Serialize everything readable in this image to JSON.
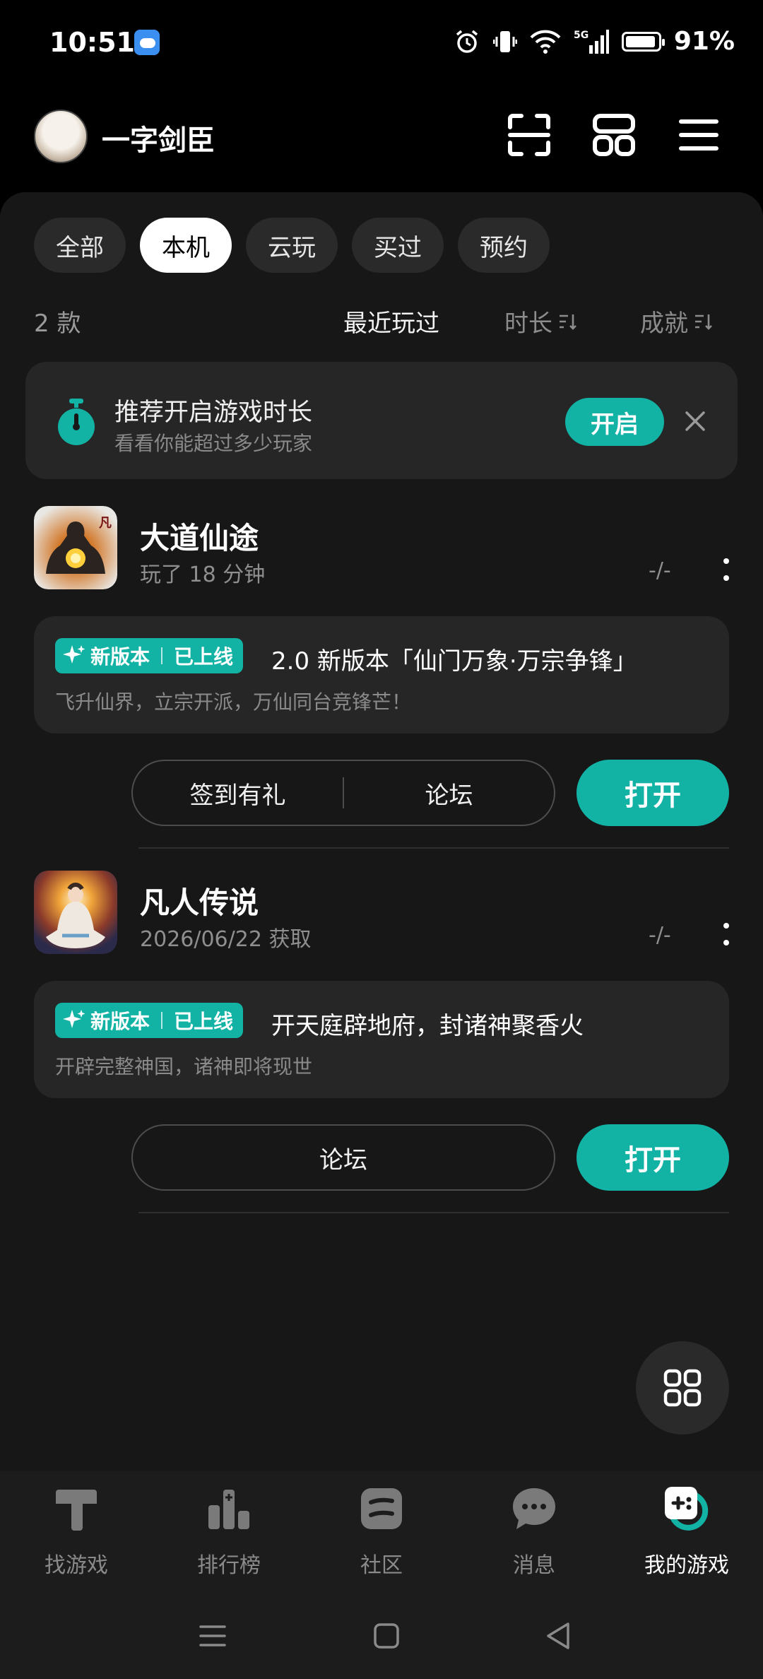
{
  "status": {
    "time": "10:51",
    "battery": "91%",
    "network": "5G"
  },
  "header": {
    "username": "一字剑臣"
  },
  "tabs": [
    {
      "label": "全部",
      "active": false
    },
    {
      "label": "本机",
      "active": true
    },
    {
      "label": "云玩",
      "active": false
    },
    {
      "label": "买过",
      "active": false
    },
    {
      "label": "预约",
      "active": false
    }
  ],
  "list": {
    "count": "2 款"
  },
  "sort": {
    "recent": "最近玩过",
    "duration": "时长",
    "achievement": "成就"
  },
  "recommend": {
    "title": "推荐开启游戏时长",
    "subtitle": "看看你能超过多少玩家",
    "button": "开启"
  },
  "games": [
    {
      "name": "大道仙途",
      "meta": "玩了 18 分钟",
      "stat": "-/-",
      "badge_a": "新版本",
      "badge_b": "已上线",
      "news_title": "2.0 新版本「仙门万象·万宗争锋」",
      "news_sub": "飞升仙界，立宗开派，万仙同台竞锋芒！",
      "action_1": "签到有礼",
      "action_2": "论坛",
      "open": "打开"
    },
    {
      "name": "凡人传说",
      "meta": "2026/06/22 获取",
      "stat": "-/-",
      "badge_a": "新版本",
      "badge_b": "已上线",
      "news_title": "开天庭辟地府，封诸神聚香火",
      "news_sub": "开辟完整神国，诸神即将现世",
      "action_1": "论坛",
      "open": "打开"
    }
  ],
  "nav": [
    {
      "label": "找游戏",
      "active": false
    },
    {
      "label": "排行榜",
      "active": false
    },
    {
      "label": "社区",
      "active": false
    },
    {
      "label": "消息",
      "active": false
    },
    {
      "label": "我的游戏",
      "active": true
    }
  ],
  "colors": {
    "accent": "#12b3a5",
    "background": "#171717",
    "card": "#262626"
  }
}
